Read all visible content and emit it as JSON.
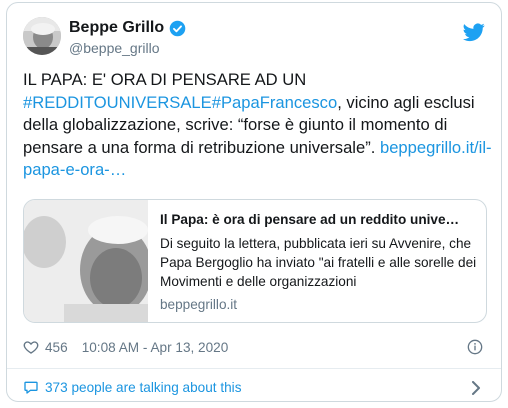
{
  "author": {
    "name": "Beppe Grillo",
    "handle": "@beppe_grillo",
    "verified": true
  },
  "tweet": {
    "text_before": "IL PAPA: E' ORA DI PENSARE AD UN ",
    "hashtag_1": "#REDDITOUNIVERSALE",
    "hashtag_2": "#PapaFrancesco",
    "text_after": ", vicino agli esclusi della globalizzazione, scrive: “forse è giunto il momento di pensare a una forma di retribuzione universale”.  ",
    "link": "beppegrillo.it/il-papa-e-ora-…"
  },
  "link_card": {
    "title": "Il Papa: è ora di pensare ad un reddito unive…",
    "description": "Di seguito la lettera, pubblicata ieri su Avvenire, che Papa Bergoglio ha inviato \"ai fratelli e alle sorelle dei Movimenti e delle organizzazioni",
    "domain": "beppegrillo.it"
  },
  "footer": {
    "likes": "456",
    "timestamp": "10:08 AM - Apr 13, 2020",
    "talking": "373 people are talking about this"
  },
  "colors": {
    "link": "#1b95e0",
    "muted": "#657786",
    "text": "#14171a",
    "border": "#cfd9de"
  },
  "icons": [
    "twitter-bird-icon",
    "verified-badge-icon",
    "heart-icon",
    "info-icon",
    "comment-bubble-icon",
    "chevron-right-icon"
  ]
}
